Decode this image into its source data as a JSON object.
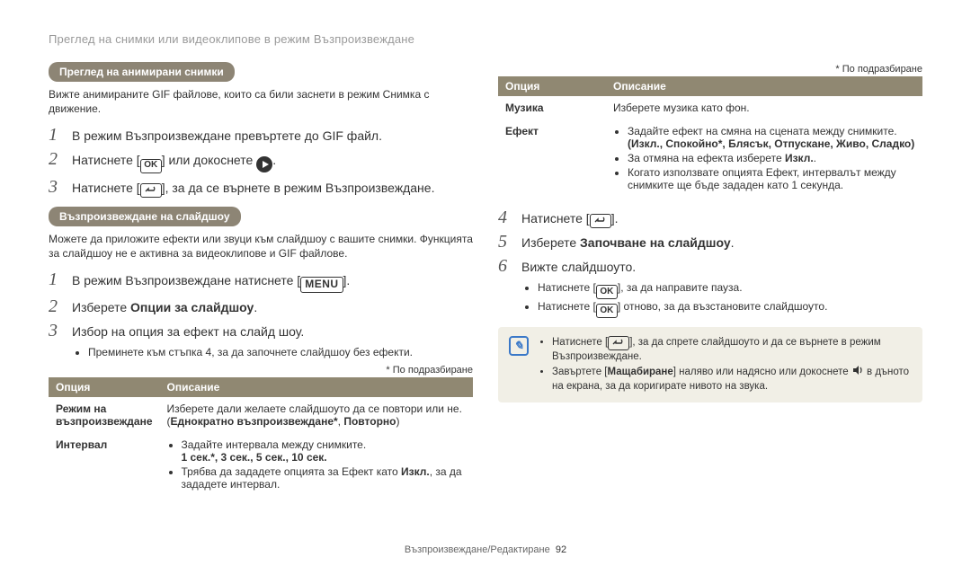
{
  "breadcrumb": "Преглед на снимки или видеоклипове в режим Възпроизвеждане",
  "left": {
    "pill1": "Преглед на анимирани снимки",
    "intro1": "Вижте анимираните GIF файлове, които са били заснети в режим Снимка с движение.",
    "s1_1a": "В режим Възпроизвеждане превъртете до GIF файл.",
    "s1_2a": "Натиснете [",
    "s1_2b": "] или докоснете ",
    "s1_2c": ".",
    "s1_3a": "Натиснете [",
    "s1_3b": "], за да се върнете в режим Възпроизвеждане.",
    "pill2": "Възпроизвеждане на слайдшоу",
    "intro2": "Можете да приложите ефекти или звуци към слайдшоу с вашите снимки. Функцията за слайдшоу не е активна за видеоклипове и GIF файлове.",
    "s2_1a": "В режим Възпроизвеждане натиснете [",
    "s2_1b": "].",
    "s2_2a": "Изберете ",
    "s2_2b": "Опции за слайдшоу",
    "s2_2c": ".",
    "s2_3": "Избор на опция за ефект на слайд шоу.",
    "s2_3bullet": "Преминете към стъпка 4, за да започнете слайдшоу без ефекти.",
    "note_default": "* По подразбиране",
    "table_h1": "Опция",
    "table_h2": "Описание",
    "t1": {
      "opt": "Режим на възпроизвеждане",
      "desc_a": "Изберете дали желаете слайдшоуто да се повтори или не. (",
      "desc_b": "Еднократно възпроизвеждане*",
      "desc_c": ", ",
      "desc_d": "Повторно",
      "desc_e": ")"
    },
    "t2": {
      "opt": "Интервал",
      "b1": "Задайте интервала между снимките.",
      "b_opts": "1 сек.*, 3 сек., 5 сек., 10 сек.",
      "b2a": "Трябва да зададете опцията за Eфект като ",
      "b2b": "Изкл.",
      "b2c": ", за да зададете интервал."
    }
  },
  "right": {
    "note_default": "* По подразбиране",
    "table_h1": "Опция",
    "table_h2": "Описание",
    "r1": {
      "opt": "Музика",
      "desc": "Изберете музика като фон."
    },
    "r2": {
      "opt": "Eфект",
      "b1": "Задайте ефект на смяна на сцената между снимките.",
      "b1_opts": "(Изкл., Спокойно*, Блясък, Отпускане, Живо, Сладко)",
      "b2a": "За отмяна на ефекта изберете ",
      "b2b": "Изкл.",
      "b2c": ".",
      "b3": "Когато използвате опцията Eфект, интервалът между снимките ще бъде зададен като 1 секунда."
    },
    "s4a": "Натиснете [",
    "s4b": "].",
    "s5a": "Изберете ",
    "s5b": "Започване на слайдшоу",
    "s5c": ".",
    "s6": "Вижте слайдшоуто.",
    "s6b1a": "Натиснете [",
    "s6b1b": "], за да направите пауза.",
    "s6b2a": "Натиснете [",
    "s6b2b": "] отново, за да възстановите слайдшоуто.",
    "tip1a": "Натиснете [",
    "tip1b": "], за да спрете слайдшоуто и да се върнете в режим Възпроизвеждане.",
    "tip2a": "Завъртете [",
    "tip2b": "Мащабиране",
    "tip2c": "] наляво или надясно или докоснете ",
    "tip2d": " в дъното на екрана, за да коригирате нивото на звука."
  },
  "footer": {
    "section": "Възпроизвеждане/Pедактиране",
    "page": "92"
  },
  "icons": {
    "ok": "OK",
    "menu": "MENU"
  }
}
